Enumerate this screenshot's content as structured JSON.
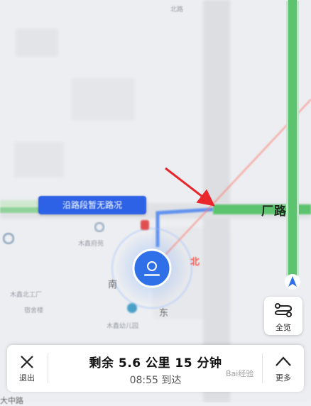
{
  "map": {
    "labels": [
      "北路",
      "木鑫府苑",
      "木鑫北工厂",
      "宿舍楼",
      "木鑫幼儿园",
      "南",
      "东",
      "北"
    ],
    "route_banner": "沿路段暂无路况",
    "current_road": "厂路",
    "north_label": "北",
    "bottom_road_label": "大中路"
  },
  "overview_button": {
    "label": "全览",
    "icon": "route-overview-icon"
  },
  "bottom_bar": {
    "exit_label": "退出",
    "remaining": "剩余 5.6 公里 15 分钟",
    "arrival": "08:55 到达",
    "more_label": "更多"
  },
  "watermark": "Bai经验",
  "colors": {
    "route_green": "#5cc46e",
    "banner_blue": "#2e62e6",
    "location_blue": "#2f6fe8",
    "arrow_red": "#e8262b"
  }
}
